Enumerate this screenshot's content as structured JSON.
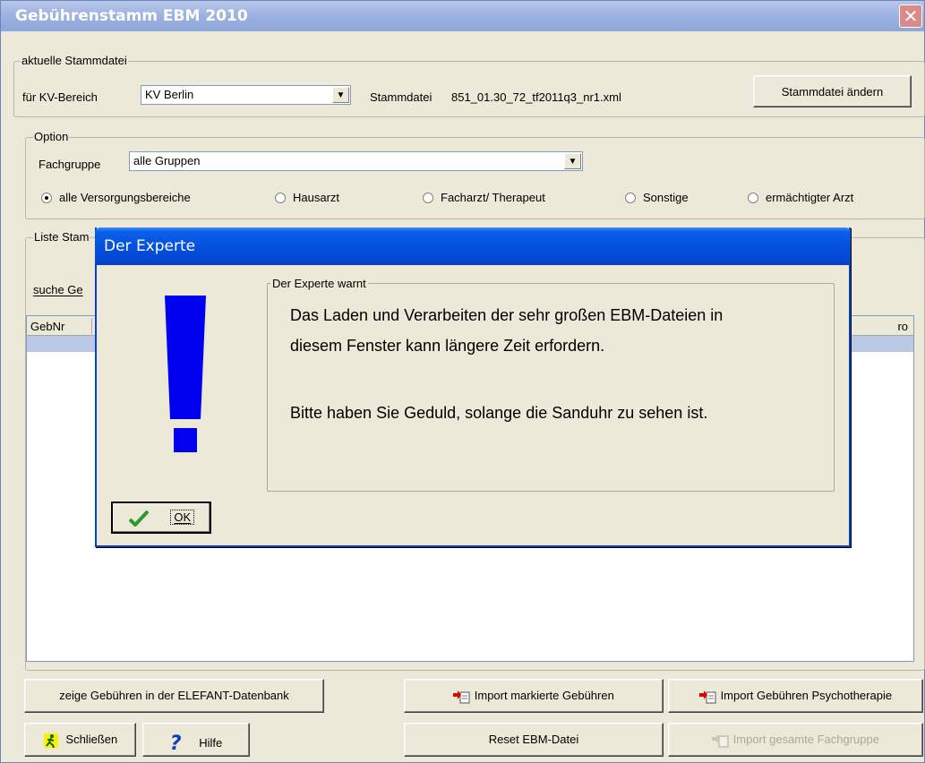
{
  "window": {
    "title": "Gebührenstamm EBM 2010",
    "close_glyph": "✕"
  },
  "stammdatei": {
    "legend": "aktuelle Stammdatei",
    "kv_label": "für KV-Bereich",
    "kv_value": "KV Berlin",
    "file_label": "Stammdatei",
    "file_value": "851_01.30_72_tf2011q3_nr1.xml",
    "change_button": "Stammdatei ändern"
  },
  "option": {
    "legend": "Option",
    "fachgruppe_label": "Fachgruppe",
    "fachgruppe_value": "alle Gruppen",
    "radios": [
      {
        "label": "alle Versorgungsbereiche",
        "selected": true
      },
      {
        "label": "Hausarzt",
        "selected": false
      },
      {
        "label": "Facharzt/ Therapeut",
        "selected": false
      },
      {
        "label": "Sonstige",
        "selected": false
      },
      {
        "label": "ermächtigter Arzt",
        "selected": false
      }
    ]
  },
  "liste": {
    "legend_partial": "Liste Stam",
    "search_partial": "suche Ge",
    "col_first": "GebNr",
    "col_last_partial": "ro"
  },
  "buttons": {
    "show_elefant": "zeige Gebühren in der ELEFANT-Datenbank",
    "import_marked": "Import markierte Gebühren",
    "import_psycho": "Import Gebühren Psychotherapie",
    "close": "Schließen",
    "help": "Hilfe",
    "reset": "Reset EBM-Datei",
    "import_all_group": "Import gesamte Fachgruppe"
  },
  "dialog": {
    "title": "Der Experte",
    "frame_legend": "Der Experte warnt",
    "line1": "Das Laden und Verarbeiten der sehr großen EBM-Dateien in",
    "line2": "diesem Fenster kann längere Zeit erfordern.",
    "line3": "Bitte haben Sie Geduld, solange die Sanduhr zu sehen ist.",
    "ok_label": "OK"
  },
  "colors": {
    "accent_blue": "#0551de",
    "exclamation": "#0000ee",
    "import_icon_red": "#e00000",
    "help_icon_blue": "#1040c0",
    "ok_check_green": "#2a9a2a"
  }
}
